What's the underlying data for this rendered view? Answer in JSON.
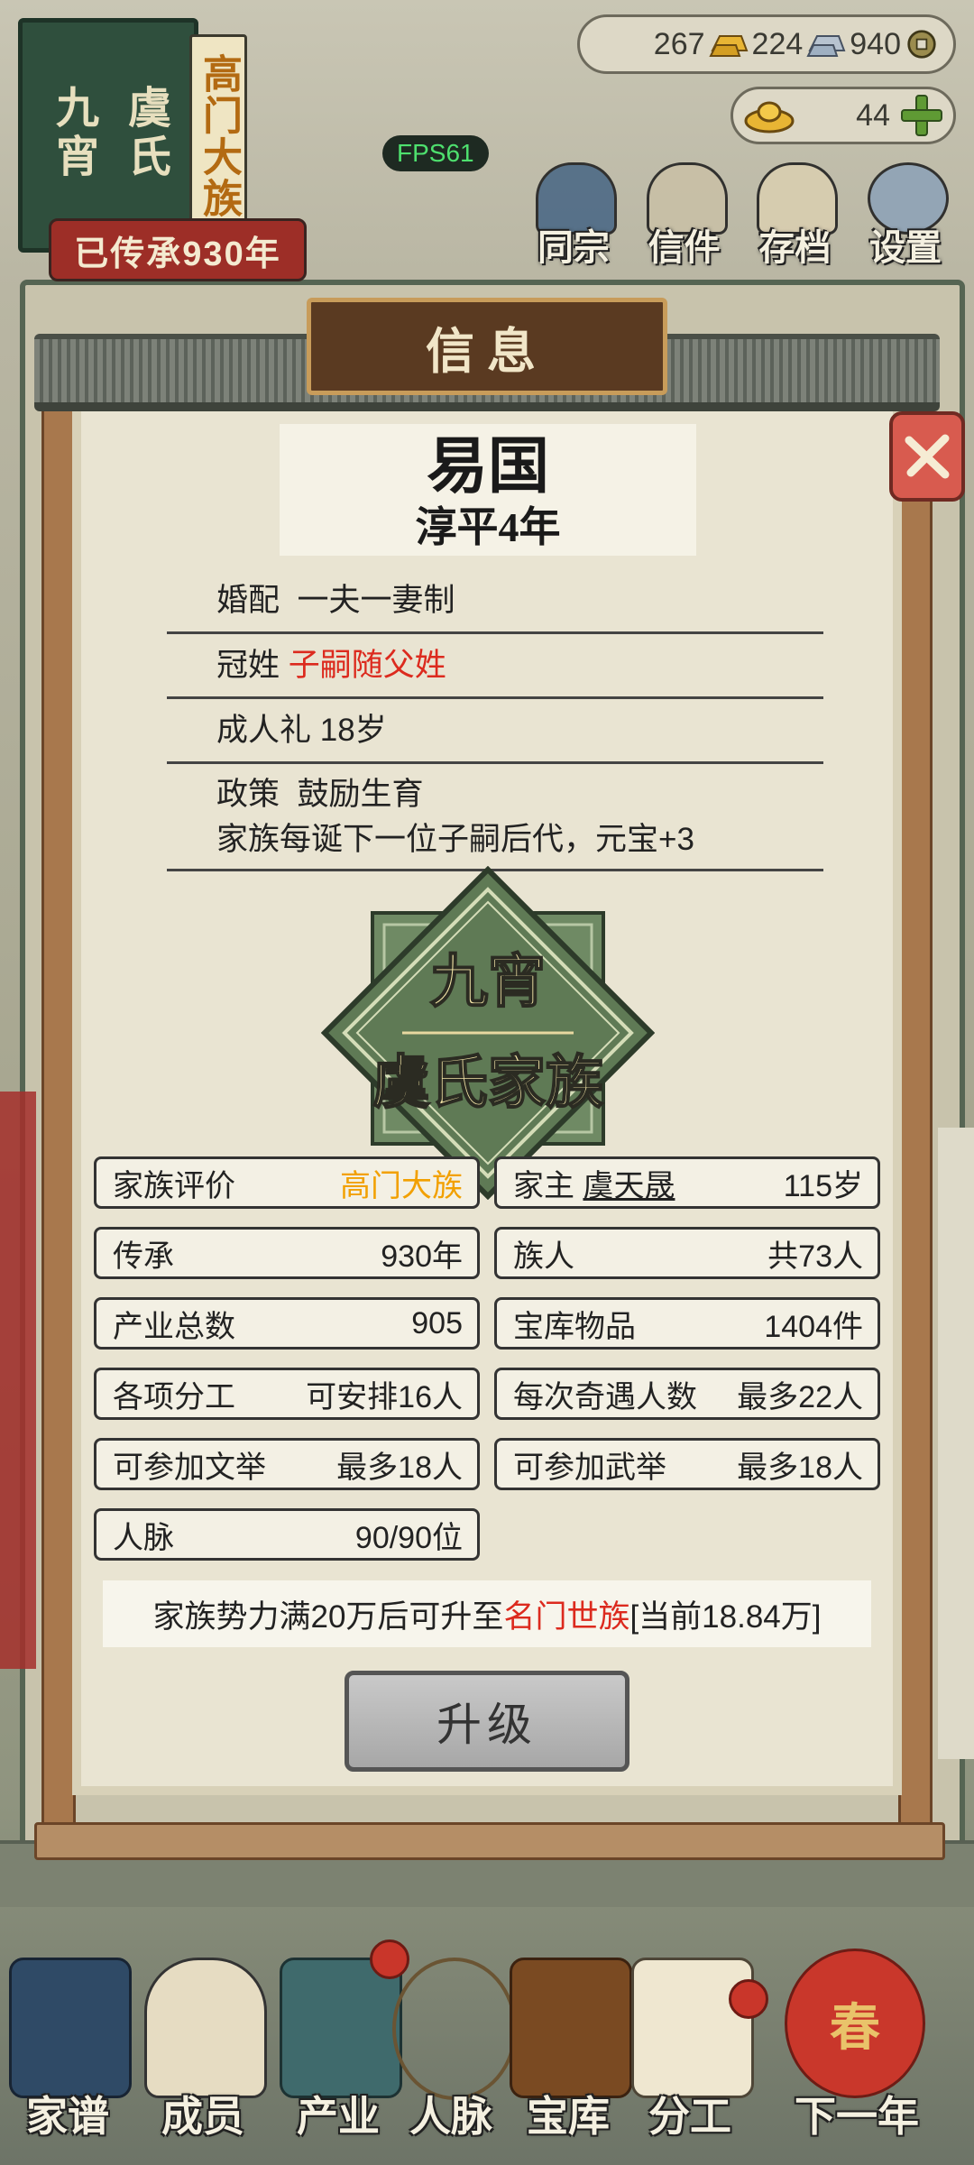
{
  "plaque": {
    "name_col1": "九宵",
    "name_col2": "虞氏",
    "rank_tag": "高门大族",
    "inherited": "已传承930年"
  },
  "currency": {
    "gold": "267",
    "silver": "224",
    "coins": "940",
    "ingots": "44"
  },
  "fps": "FPS61",
  "top_nav": [
    {
      "label": "同宗",
      "icon": "books-icon"
    },
    {
      "label": "信件",
      "icon": "letters-icon"
    },
    {
      "label": "存档",
      "icon": "save-scroll-icon"
    },
    {
      "label": "设置",
      "icon": "gear-icon"
    }
  ],
  "dialog": {
    "title": "信息",
    "country": "易国",
    "era": "淳平4年",
    "rules": {
      "marriage_label": "婚配",
      "marriage_value": "一夫一妻制",
      "surname_label": "冠姓",
      "surname_value": "子嗣随父姓",
      "adult_label": "成人礼",
      "adult_value": "18岁",
      "policy_label": "政策",
      "policy_value": "鼓励生育",
      "policy_desc": "家族每诞下一位子嗣后代，元宝+3"
    },
    "emblem": {
      "line1": "九宵",
      "line2": "虞氏家族"
    },
    "stats": [
      {
        "label": "家族评价",
        "value": "高门大族"
      },
      {
        "label": "家主",
        "name": "虞天晟",
        "value": "115岁"
      },
      {
        "label": "传承",
        "value": "930年"
      },
      {
        "label": "族人",
        "value": "共73人"
      },
      {
        "label": "产业总数",
        "value": "905"
      },
      {
        "label": "宝库物品",
        "value": "1404件"
      },
      {
        "label": "各项分工",
        "value": "可安排16人"
      },
      {
        "label": "每次奇遇人数",
        "value": "最多22人"
      },
      {
        "label": "可参加文举",
        "value": "最多18人"
      },
      {
        "label": "可参加武举",
        "value": "最多18人"
      },
      {
        "label": "人脉",
        "value": "90/90位"
      }
    ],
    "notice": {
      "prefix": "家族势力满20万后可升至",
      "target": "名门世族",
      "suffix": "[当前18.84万]"
    },
    "upgrade_label": "升级"
  },
  "bottom_nav": [
    {
      "label": "家谱",
      "icon": "genealogy-book-icon"
    },
    {
      "label": "成员",
      "icon": "member-portrait-icon"
    },
    {
      "label": "产业",
      "icon": "building-icon"
    },
    {
      "label": "人脉",
      "icon": "network-icon"
    },
    {
      "label": "宝库",
      "icon": "treasure-chest-icon"
    },
    {
      "label": "分工",
      "icon": "scroll-icon"
    },
    {
      "label": "下一年",
      "icon": "lantern-icon"
    }
  ],
  "lantern_char": "春",
  "colors": {
    "accent_red": "#dc2a1e",
    "accent_orange": "#f2a000",
    "emblem_green": "#5f7a55",
    "emblem_text": "#f5e7a8",
    "fps_green": "#4ee06e"
  }
}
